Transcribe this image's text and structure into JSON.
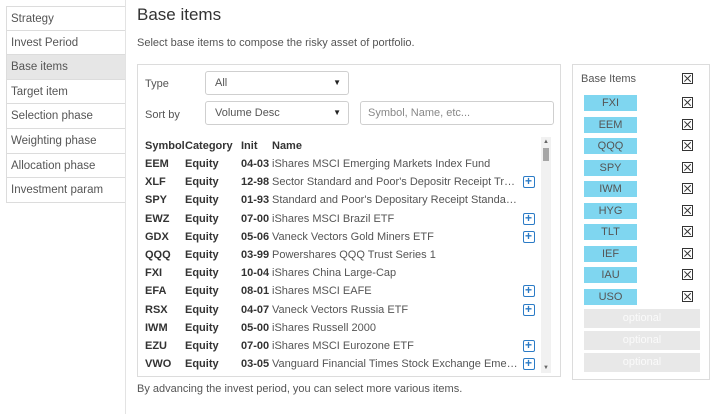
{
  "sidebar": {
    "items": [
      {
        "label": "Strategy"
      },
      {
        "label": "Invest Period"
      },
      {
        "label": "Base items"
      },
      {
        "label": "Target item"
      },
      {
        "label": "Selection phase"
      },
      {
        "label": "Weighting phase"
      },
      {
        "label": "Allocation phase"
      },
      {
        "label": "Investment param"
      }
    ],
    "active_index": 2
  },
  "header": {
    "title": "Base items",
    "subtitle": "Select base items to compose the risky asset of portfolio."
  },
  "filters": {
    "type_label": "Type",
    "type_value": "All",
    "sort_label": "Sort by",
    "sort_value": "Volume Desc",
    "search_placeholder": "Symbol, Name, etc..."
  },
  "table": {
    "columns": {
      "symbol": "Symbol",
      "category": "Category",
      "init": "Init",
      "name": "Name"
    },
    "rows": [
      {
        "symbol": "EEM",
        "category": "Equity",
        "init": "04-03",
        "name": "iShares MSCI Emerging Markets Index Fund",
        "add": false
      },
      {
        "symbol": "XLF",
        "category": "Equity",
        "init": "12-98",
        "name": "Sector Standard and Poor's Depositr Receipt Trust Inde...",
        "add": true
      },
      {
        "symbol": "SPY",
        "category": "Equity",
        "init": "01-93",
        "name": "Standard and Poor's Depositary Receipt Standard ...",
        "add": false
      },
      {
        "symbol": "EWZ",
        "category": "Equity",
        "init": "07-00",
        "name": "iShares MSCI Brazil ETF",
        "add": true
      },
      {
        "symbol": "GDX",
        "category": "Equity",
        "init": "05-06",
        "name": "Vaneck Vectors Gold Miners ETF",
        "add": true
      },
      {
        "symbol": "QQQ",
        "category": "Equity",
        "init": "03-99",
        "name": "Powershares QQQ Trust Series 1",
        "add": false
      },
      {
        "symbol": "FXI",
        "category": "Equity",
        "init": "10-04",
        "name": "iShares China Large-Cap",
        "add": false
      },
      {
        "symbol": "EFA",
        "category": "Equity",
        "init": "08-01",
        "name": "iShares MSCI EAFE",
        "add": true
      },
      {
        "symbol": "RSX",
        "category": "Equity",
        "init": "04-07",
        "name": "Vaneck Vectors Russia ETF",
        "add": true
      },
      {
        "symbol": "IWM",
        "category": "Equity",
        "init": "05-00",
        "name": "iShares Russell 2000",
        "add": false
      },
      {
        "symbol": "EZU",
        "category": "Equity",
        "init": "07-00",
        "name": "iShares MSCI Eurozone ETF",
        "add": true
      },
      {
        "symbol": "VWO",
        "category": "Equity",
        "init": "03-05",
        "name": "Vanguard Financial Times Stock Exchange Emergi...",
        "add": true
      }
    ]
  },
  "base_items": {
    "title": "Base Items",
    "items": [
      "FXI",
      "EEM",
      "QQQ",
      "SPY",
      "IWM",
      "HYG",
      "TLT",
      "IEF",
      "IAU",
      "USO"
    ],
    "optional_label": "optional",
    "optional_count": 3
  },
  "footer": {
    "note": "By advancing the invest period, you can select more various items."
  },
  "colors": {
    "chip": "#7fd6f0",
    "add_icon": "#2b7bc6",
    "active_sidebar": "#e6e6e6"
  }
}
